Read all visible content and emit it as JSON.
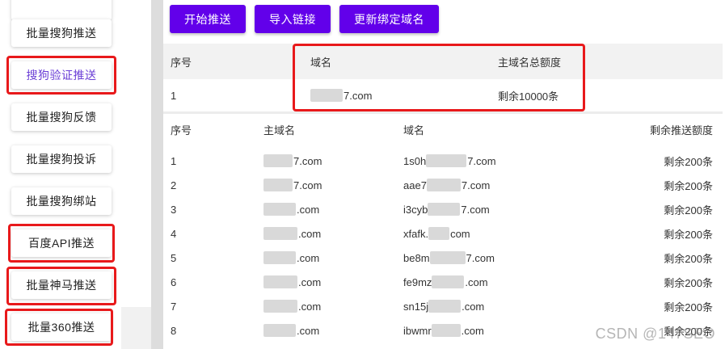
{
  "sidebar": {
    "items": [
      {
        "label": "批量搜狗推送",
        "active": false
      },
      {
        "label": "搜狗验证推送",
        "active": true
      },
      {
        "label": "批量搜狗反馈",
        "active": false
      },
      {
        "label": "批量搜狗投诉",
        "active": false
      },
      {
        "label": "批量搜狗绑站",
        "active": false
      },
      {
        "label": "百度API推送",
        "active": false
      },
      {
        "label": "批量神马推送",
        "active": false
      },
      {
        "label": "批量360推送",
        "active": false
      }
    ]
  },
  "toolbar": {
    "start_label": "开始推送",
    "import_label": "导入链接",
    "update_label": "更新绑定域名"
  },
  "quota_table": {
    "headers": {
      "index": "序号",
      "domain": "域名",
      "quota": "主域名总额度"
    },
    "row": {
      "index": "1",
      "domain": "7.com",
      "quota": "剩余10000条"
    }
  },
  "push_table": {
    "headers": {
      "index": "序号",
      "main_domain": "主域名",
      "domain": "域名",
      "remaining": "剩余推送额度"
    },
    "rows": [
      {
        "index": "1",
        "main_domain": "7.com",
        "domain_prefix": "1s0h",
        "domain_suffix": "7.com",
        "remaining": "剩余200条"
      },
      {
        "index": "2",
        "main_domain": "7.com",
        "domain_prefix": "aae7",
        "domain_suffix": "7.com",
        "remaining": "剩余200条"
      },
      {
        "index": "3",
        "main_domain": ".com",
        "domain_prefix": "i3cyb",
        "domain_suffix": "7.com",
        "remaining": "剩余200条"
      },
      {
        "index": "4",
        "main_domain": ".com",
        "domain_prefix": "xfafk.",
        "domain_suffix": "com",
        "remaining": "剩余200条"
      },
      {
        "index": "5",
        "main_domain": ".com",
        "domain_prefix": "be8m",
        "domain_suffix": "7.com",
        "remaining": "剩余200条"
      },
      {
        "index": "6",
        "main_domain": ".com",
        "domain_prefix": "fe9mz",
        "domain_suffix": ".com",
        "remaining": "剩余200条"
      },
      {
        "index": "7",
        "main_domain": ".com",
        "domain_prefix": "sn15j",
        "domain_suffix": ".com",
        "remaining": "剩余200条"
      },
      {
        "index": "8",
        "main_domain": ".com",
        "domain_prefix": "ibwmr",
        "domain_suffix": ".com",
        "remaining": "剩余200条"
      }
    ]
  },
  "watermark": "CSDN @147SEO",
  "colors": {
    "primary": "#6200ea",
    "active_text": "#6b3fd6",
    "highlight": "#e8191b"
  }
}
